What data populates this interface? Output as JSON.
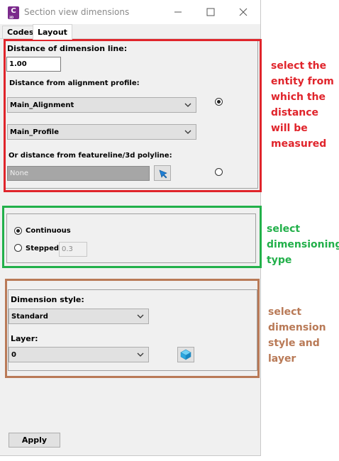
{
  "window": {
    "title": "Section view dimensions",
    "app_icon_letter": "C",
    "app_icon_sub": "3D"
  },
  "tabs": [
    {
      "label": "Codes",
      "active": false
    },
    {
      "label": "Layout",
      "active": true
    }
  ],
  "distance_group": {
    "distance_label": "Distance of dimension line:",
    "distance_value": "1.00",
    "from_profile_label": "Distance from alignment profile:",
    "alignment_value": "Main_Alignment",
    "profile_value": "Main_Profile",
    "from_featureline_label": "Or distance from featureline/3d polyline:",
    "featureline_value": "None",
    "profile_radio_selected": true,
    "featureline_radio_selected": false
  },
  "type_group": {
    "continuous_label": "Continuous",
    "stepped_label": "Stepped",
    "stepped_value": "0.3",
    "continuous_selected": true
  },
  "style_group": {
    "style_label": "Dimension style:",
    "style_value": "Standard",
    "layer_label": "Layer:",
    "layer_value": "0"
  },
  "apply_label": "Apply",
  "annotations": {
    "red": {
      "lines": [
        "select the",
        "entity from",
        "which the",
        "distance",
        "will be",
        "measured"
      ],
      "color": "#e0242b"
    },
    "green": {
      "lines": [
        "select",
        "dimensioning",
        "type"
      ],
      "color": "#22b04a"
    },
    "brown": {
      "lines": [
        "select",
        "dimension",
        "style and",
        "layer"
      ],
      "color": "#b97a57"
    }
  },
  "icons": [
    "app-logo-icon",
    "minimize-icon",
    "maximize-icon",
    "close-icon",
    "chevron-down-icon",
    "pick-cursor-icon",
    "layer-cube-icon"
  ]
}
